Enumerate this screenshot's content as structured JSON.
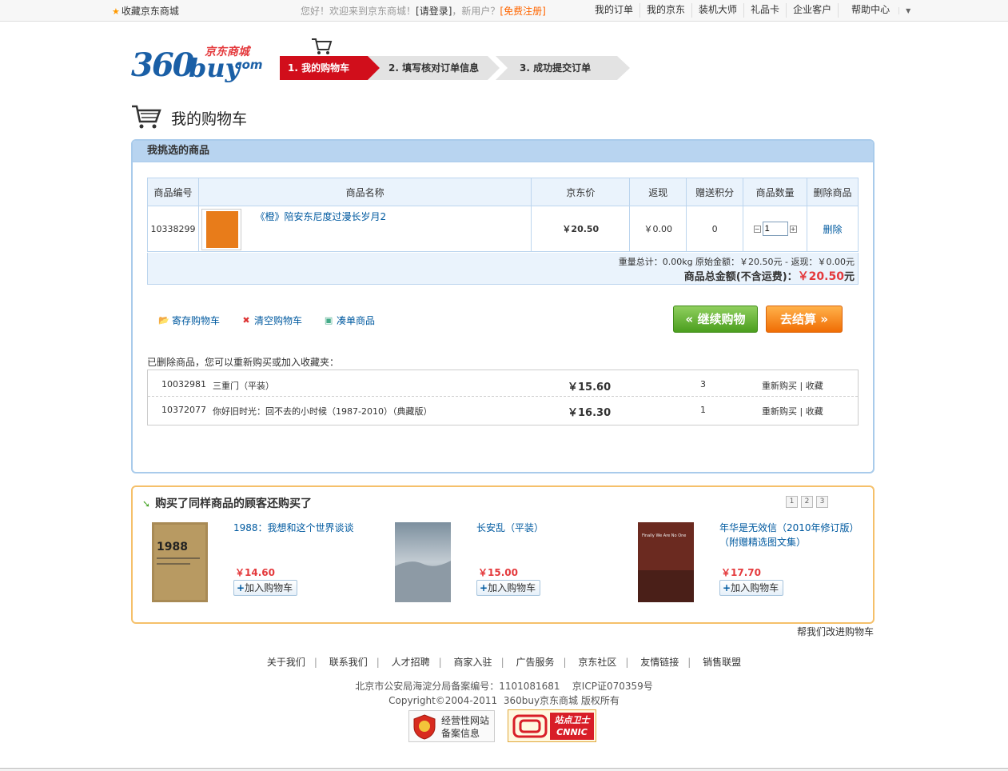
{
  "topbar": {
    "favorite": "收藏京东商城",
    "welcome": "您好！欢迎来到京东商城！",
    "login": "[请登录]",
    "new_user": "，新用户？",
    "register": "[免费注册]",
    "nav": [
      "我的订单",
      "我的京东",
      "装机大师",
      "礼品卡",
      "企业客户",
      "帮助中心"
    ]
  },
  "logo": {
    "n360": "360",
    "buy": "buy",
    "com": ".com",
    "jd": "京东商城"
  },
  "steps": [
    "1. 我的购物车",
    "2. 填写核对订单信息",
    "3. 成功提交订单"
  ],
  "page_title": "我的购物车",
  "cart": {
    "header": "我挑选的商品",
    "columns": [
      "商品编号",
      "商品名称",
      "京东价",
      "返现",
      "赠送积分",
      "商品数量",
      "删除商品"
    ],
    "items": [
      {
        "id": "10338299",
        "name": "《橙》陪安东尼度过漫长岁月2",
        "price": "￥20.50",
        "cashback": "￥0.00",
        "points": "0",
        "qty": "1",
        "delete": "删除"
      }
    ],
    "summary_line1": "重量总计：0.00kg    原始金额：￥20.50元 - 返现：￥0.00元",
    "summary_label": "商品总金额(不含运费)：",
    "summary_total": "￥20.50",
    "summary_unit": "元"
  },
  "actions": {
    "save_cart": "寄存购物车",
    "clear_cart": "清空购物车",
    "bundle": "凑单商品",
    "continue": "继续购物",
    "checkout": "去结算"
  },
  "deleted": {
    "label": "已删除商品，您可以重新购买或加入收藏夹：",
    "rows": [
      {
        "id": "10032981",
        "name": "三重门（平装）",
        "price": "￥15.60",
        "qty": "3",
        "action": "重新购买 | 收藏"
      },
      {
        "id": "10372077",
        "name": "你好旧时光：回不去的小时候（1987-2010）（典藏版）",
        "price": "￥16.30",
        "qty": "1",
        "action": "重新购买 | 收藏"
      }
    ]
  },
  "recommend": {
    "title": "购买了同样商品的顾客还购买了",
    "pages": [
      "1",
      "2",
      "3"
    ],
    "items": [
      {
        "name": "1988：我想和这个世界谈谈",
        "price": "￥14.60",
        "add": "加入购物车",
        "cover_text": "1988"
      },
      {
        "name": "长安乱（平装）",
        "price": "￥15.00",
        "add": "加入购物车",
        "cover_text": ""
      },
      {
        "name": "年华是无效信（2010年修订版）（附赠精选图文集）",
        "price": "￥17.70",
        "add": "加入购物车",
        "cover_text": "Finally We Are No One"
      }
    ]
  },
  "feedback": "帮我们改进购物车",
  "footer": {
    "links": [
      "关于我们",
      "联系我们",
      "人才招聘",
      "商家入驻",
      "广告服务",
      "京东社区",
      "友情链接",
      "销售联盟"
    ],
    "beian": "北京市公安局海淀分局备案编号：1101081681    京ICP证070359号",
    "copyright": "Copyright©2004-2011  360buy京东商城 版权所有",
    "badge1_line1": "经营性网站",
    "badge1_line2": "备案信息",
    "badge2_line1": "站点卫士",
    "badge2_line2": "CNNIC"
  },
  "colors": {
    "brand_red": "#e4393c",
    "link_blue": "#005aa0",
    "cart_border": "#a9cbeb",
    "rec_border": "#f5c06a"
  }
}
